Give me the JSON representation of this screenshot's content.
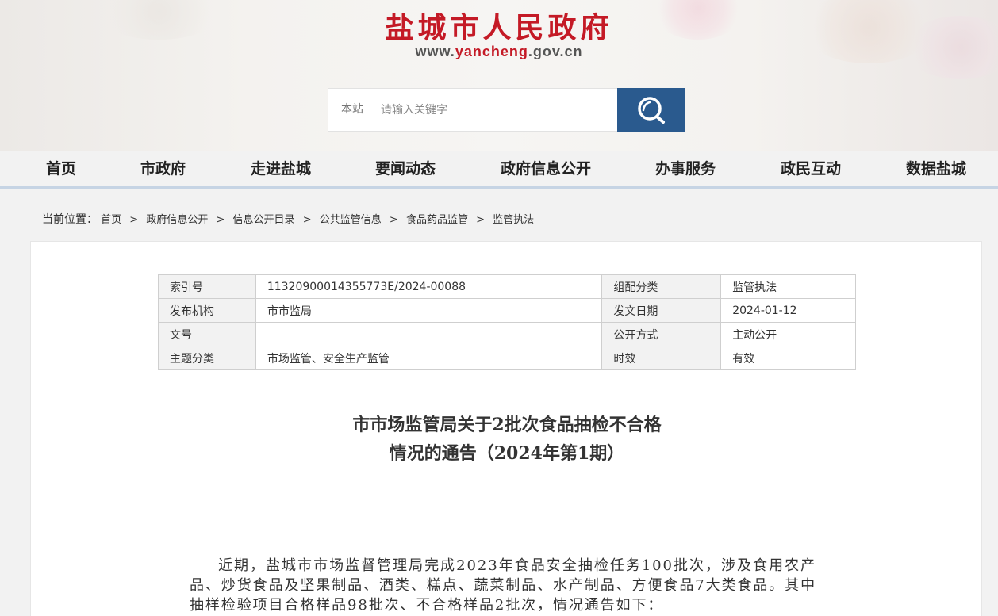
{
  "header": {
    "site_title": "盐城市人民政府",
    "domain_prefix": "www.",
    "domain_highlight": "yancheng",
    "domain_suffix": ".gov.cn",
    "brand_color": "#c41a26"
  },
  "search": {
    "scope": "本站",
    "placeholder": "请输入关键字",
    "button_icon": "search-icon",
    "button_color": "#2a5a8e"
  },
  "nav": {
    "items": [
      "首页",
      "市政府",
      "走进盐城",
      "要闻动态",
      "政府信息公开",
      "办事服务",
      "政民互动",
      "数据盐城"
    ]
  },
  "breadcrumb": {
    "label": "当前位置：",
    "items": [
      "首页",
      "政府信息公开",
      "信息公开目录",
      "公共监管信息",
      "食品药品监管",
      "监管执法"
    ],
    "separator": ">"
  },
  "meta": {
    "rows": [
      {
        "k1": "索引号",
        "v1": "11320900014355773E/2024-00088",
        "k2": "组配分类",
        "v2": "监管执法"
      },
      {
        "k1": "发布机构",
        "v1": "市市监局",
        "k2": "发文日期",
        "v2": "2024-01-12"
      },
      {
        "k1": "文号",
        "v1": "",
        "k2": "公开方式",
        "v2": "主动公开"
      },
      {
        "k1": "主题分类",
        "v1": "市场监管、安全生产监管",
        "k2": "时效",
        "v2": "有效"
      }
    ]
  },
  "article": {
    "title_line1": "市市场监管局关于2批次食品抽检不合格",
    "title_line2": "情况的通告（2024年第1期）",
    "body": "近期，盐城市市场监督管理局完成2023年食品安全抽检任务100批次，涉及食用农产品、炒货食品及坚果制品、酒类、糕点、蔬菜制品、水产制品、方便食品7大类食品。其中抽样检验项目合格样品98批次、不合格样品2批次，情况通告如下："
  }
}
